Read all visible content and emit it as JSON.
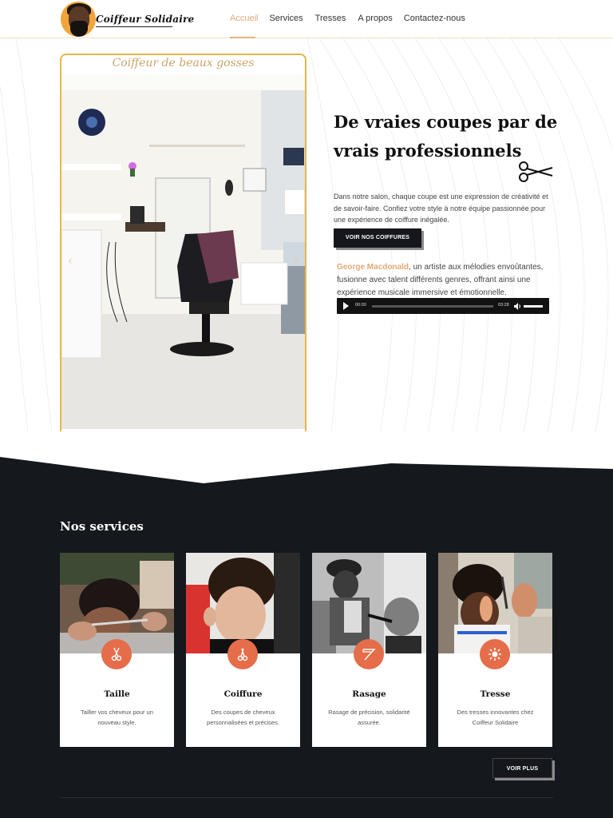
{
  "header": {
    "logo_text": "Coiffeur Solidaire",
    "nav": [
      {
        "label": "Accueil",
        "active": true
      },
      {
        "label": "Services",
        "active": false
      },
      {
        "label": "Tresses",
        "active": false
      },
      {
        "label": "A propos",
        "active": false
      },
      {
        "label": "Contactez-nous",
        "active": false
      }
    ]
  },
  "hero": {
    "slider_caption": "Coiffeur de beaux gosses",
    "slide_count": 7,
    "active_slide": 2,
    "title": "De vraies coupes par de vrais professionnels",
    "text": "Dans notre salon, chaque coupe est une expression de créativité et de savoir-faire. Confiez votre style à notre équipe passionnée pour une expérience de coiffure inégalée.",
    "cta": "VOIR NOS COIFFURES",
    "music": {
      "artist": "George Macdonald",
      "text": ", un artiste aux mélodies envoûtantes, fusionne avec talent différents genres, offrant ainsi une expérience musicale immersive et émotionnelle."
    },
    "player": {
      "current_time": "00:00",
      "duration": "03:28"
    }
  },
  "services": {
    "title": "Nos services",
    "cards": [
      {
        "title": "Taille",
        "desc": "Tailler vos cheveux pour un nouveau style.",
        "icon": "scissors-icon"
      },
      {
        "title": "Coiffure",
        "desc": "Des coupes de cheveux personnalisées et précises.",
        "icon": "comb-scissors-icon"
      },
      {
        "title": "Rasage",
        "desc": "Rasage de précision, solidarité assurée.",
        "icon": "razor-icon"
      },
      {
        "title": "Tresse",
        "desc": "Des tresses innovantes chez Coiffeur Solidaire",
        "icon": "braid-icon"
      }
    ],
    "more": "VOIR PLUS"
  },
  "colors": {
    "accent": "#e8b27a",
    "badge": "#e66d4a",
    "dark": "#15181d",
    "slider_border": "#e9b54a"
  }
}
